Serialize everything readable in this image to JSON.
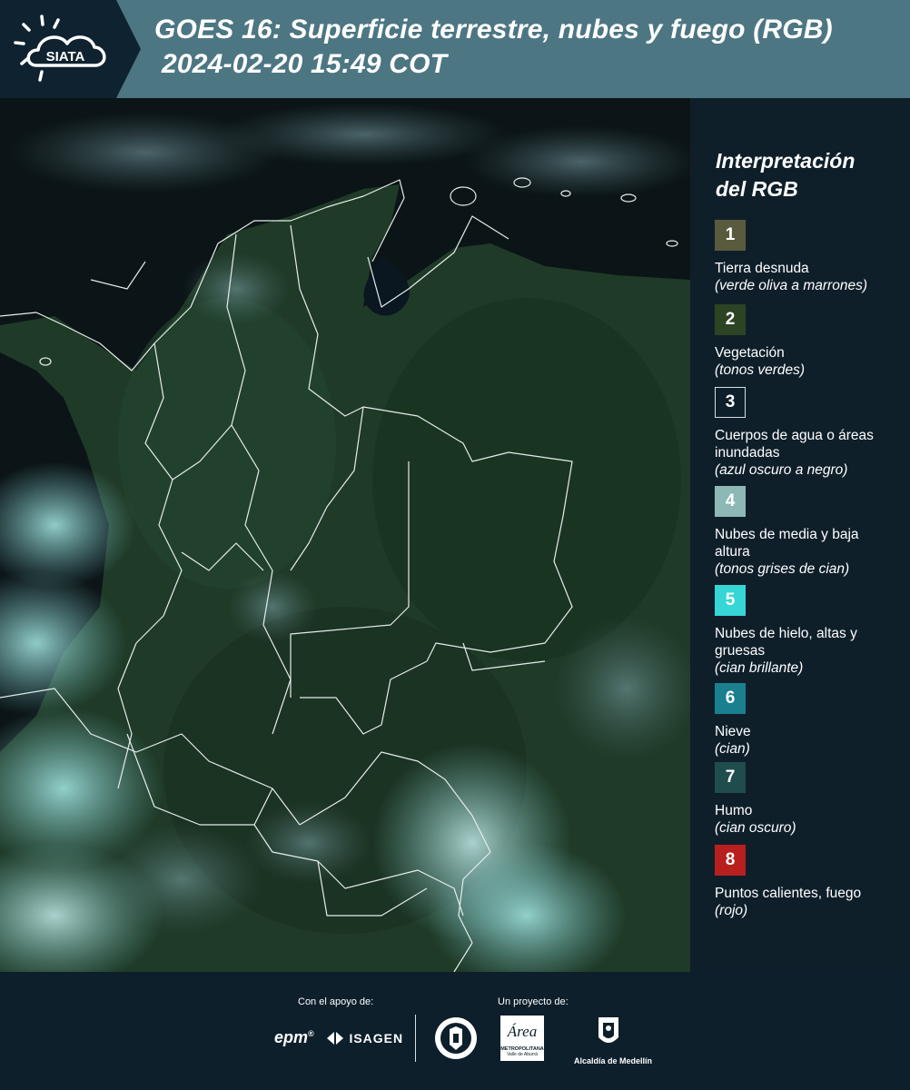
{
  "header": {
    "logo_text": "SIATA",
    "title_line1": "GOES 16: Superficie terrestre, nubes y fuego (RGB)",
    "title_line2": "2024-02-20 15:49 COT"
  },
  "map": {
    "description": "",
    "land_color": "#1d3a26",
    "cloud_color": "#7fcfcf",
    "border_color": "#e6ecec"
  },
  "legend": {
    "title_line1": "Interpretación",
    "title_line2": "del RGB",
    "items": [
      {
        "number": "1",
        "color": "#5a5a3e",
        "label": "Tierra desnuda",
        "hint": "(verde oliva a marrones)"
      },
      {
        "number": "2",
        "color": "#2c4423",
        "label": "Vegetación",
        "hint": "(tonos verdes)"
      },
      {
        "number": "3",
        "color": "#0d1f2b",
        "label": "Cuerpos de agua o áreas inundadas",
        "hint": "(azul oscuro a negro)"
      },
      {
        "number": "4",
        "color": "#8db8b5",
        "label": "Nubes de media y baja altura",
        "hint": "(tonos grises de cian)"
      },
      {
        "number": "5",
        "color": "#36d6d6",
        "label": "Nubes de hielo, altas y gruesas",
        "hint": "(cian brillante)"
      },
      {
        "number": "6",
        "color": "#1a8090",
        "label": "Nieve",
        "hint": "(cian)"
      },
      {
        "number": "7",
        "color": "#1f4c4c",
        "label": "Humo",
        "hint": "(cian oscuro)"
      },
      {
        "number": "8",
        "color": "#b81f1f",
        "label": "Puntos calientes, fuego",
        "hint": "(rojo)"
      }
    ]
  },
  "footer": {
    "support_caption": "Con el apoyo de:",
    "project_caption": "Un proyecto de:",
    "partners": {
      "epm": "epm",
      "isagen": "ISAGEN",
      "metropolitana_title": "Área",
      "metropolitana_sub1": "METROPOLITANA",
      "metropolitana_sub2": "Valle de Aburrá",
      "alcaldia": "Alcaldía de Medellín"
    }
  }
}
